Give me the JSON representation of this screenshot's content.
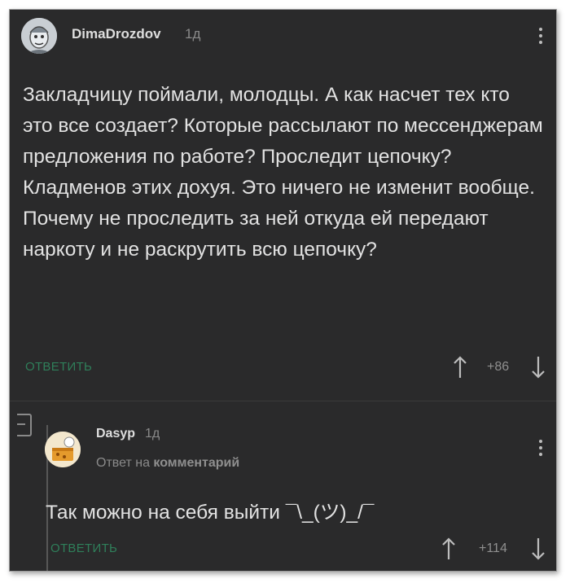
{
  "comment1": {
    "author": "DimaDrozdov",
    "time": "1д",
    "paragraph1": "Закладчицу поймали, молодцы. А как насчет тех кто это все создает? Которые рассылают по мессенджерам предложения по работе? Проследит цепочку?",
    "paragraph2": "Кладменов этих дохуя. Это ничего не изменит вообще. Почему не проследить за ней откуда ей передают наркоту и не раскрутить всю цепочку?",
    "reply_label": "ОТВЕТИТЬ",
    "score": "+86"
  },
  "comment2": {
    "author": "Dasyp",
    "time": "1д",
    "reply_to_prefix": "Ответ на",
    "reply_to_target": "комментарий",
    "text": "Так можно на себя выйти ¯\\_(ツ)_/¯",
    "reply_label": "ОТВЕТИТЬ",
    "score": "+114"
  },
  "icons": {
    "upvote": "arrow-up-icon",
    "downvote": "arrow-down-icon",
    "menu": "kebab-menu-icon",
    "collapse": "collapse-thread-icon"
  },
  "colors": {
    "background": "#2a2a2b",
    "accent": "#2f7f5a",
    "text": "#e2e2e2",
    "muted": "#8a8a8a"
  }
}
